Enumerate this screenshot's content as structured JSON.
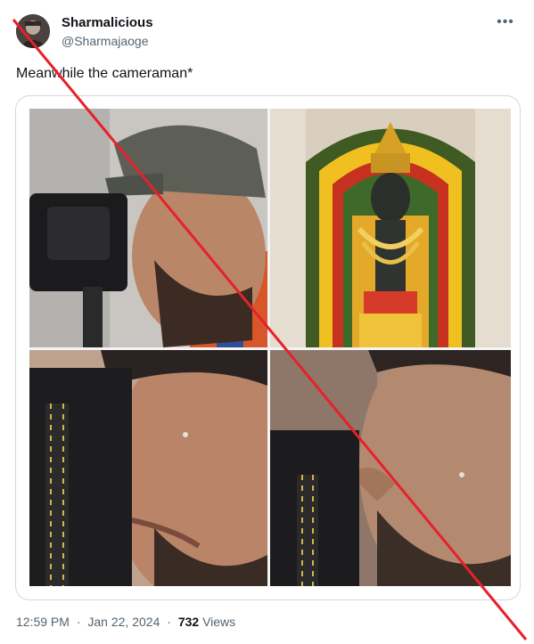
{
  "author": {
    "display_name": "Sharmalicious",
    "handle": "@Sharmajaoge"
  },
  "tweet": {
    "text": "Meanwhile the cameraman*"
  },
  "menu": {
    "more_label": "•••"
  },
  "media": {
    "photos": [
      {
        "icon": "photographer-crying-cap-photo"
      },
      {
        "icon": "deity-idol-with-garlands-photo"
      },
      {
        "icon": "photographer-closeup-tears-photo"
      },
      {
        "icon": "photographer-side-profile-tears-photo"
      }
    ]
  },
  "meta": {
    "time": "12:59 PM",
    "separator": "·",
    "date": "Jan 22, 2024",
    "views_count": "732",
    "views_label": "Views"
  },
  "overlay": {
    "cross_color": "#e8202a"
  }
}
